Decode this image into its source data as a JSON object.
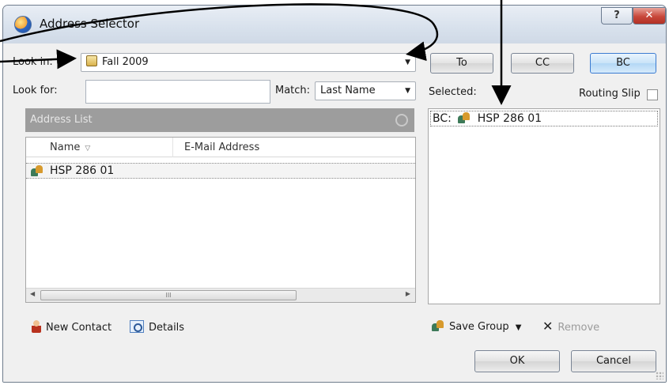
{
  "window": {
    "title": "Address Selector",
    "help_label": "?",
    "close_label": "✕"
  },
  "left": {
    "look_in_label": "Look in:",
    "look_in_value": "Fall 2009",
    "look_for_label": "Look for:",
    "look_for_value": "",
    "match_label": "Match:",
    "match_value": "Last Name",
    "address_list_label": "Address List",
    "columns": [
      "Name",
      "E-Mail Address"
    ],
    "rows": [
      {
        "name": "HSP 286 01",
        "email": ""
      }
    ],
    "new_contact_label": "New Contact",
    "details_label": "Details"
  },
  "right": {
    "to_label": "To",
    "cc_label": "CC",
    "bc_label": "BC",
    "selected_label": "Selected:",
    "routing_slip_label": "Routing Slip",
    "routing_slip_checked": false,
    "selected_entries": [
      {
        "prefix": "BC:",
        "name": "HSP 286 01"
      }
    ],
    "save_group_label": "Save Group",
    "remove_label": "Remove"
  },
  "footer": {
    "ok_label": "OK",
    "cancel_label": "Cancel"
  },
  "icons": {
    "app": "address-book-icon",
    "look_in": "folder-icon",
    "group": "group-icon",
    "contact": "contact-icon",
    "details": "magnifier-card-icon",
    "remove": "x-icon"
  },
  "colors": {
    "address_list_header": "#9d9d9d",
    "close_button": "#c8473a",
    "default_button_border": "#3b7bd1"
  }
}
